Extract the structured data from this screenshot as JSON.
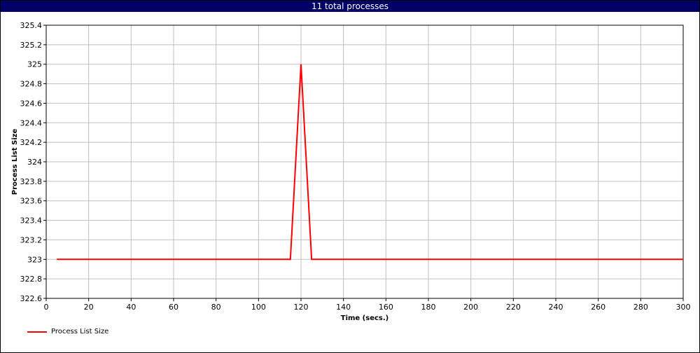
{
  "title": "11 total processes",
  "colors": {
    "title_bar": "#000066",
    "series": "#ff0000",
    "grid": "#c0c0c0",
    "axis": "#000000"
  },
  "chart_data": {
    "type": "line",
    "title": "11 total processes",
    "xlabel": "Time (secs.)",
    "ylabel": "Process List Size",
    "xlim": [
      0,
      300
    ],
    "ylim": [
      322.6,
      325.4
    ],
    "xticks": [
      0,
      20,
      40,
      60,
      80,
      100,
      120,
      140,
      160,
      180,
      200,
      220,
      240,
      260,
      280,
      300
    ],
    "yticks": [
      322.6,
      322.8,
      323,
      323.2,
      323.4,
      323.6,
      323.8,
      324,
      324.2,
      324.4,
      324.6,
      324.8,
      325,
      325.2,
      325.4
    ],
    "grid": true,
    "legend_position": "bottom-left",
    "series": [
      {
        "name": "Process List Size",
        "color": "#ff0000",
        "x": [
          5,
          115,
          120,
          125,
          300
        ],
        "y": [
          323,
          323,
          325,
          323,
          323
        ]
      }
    ]
  }
}
